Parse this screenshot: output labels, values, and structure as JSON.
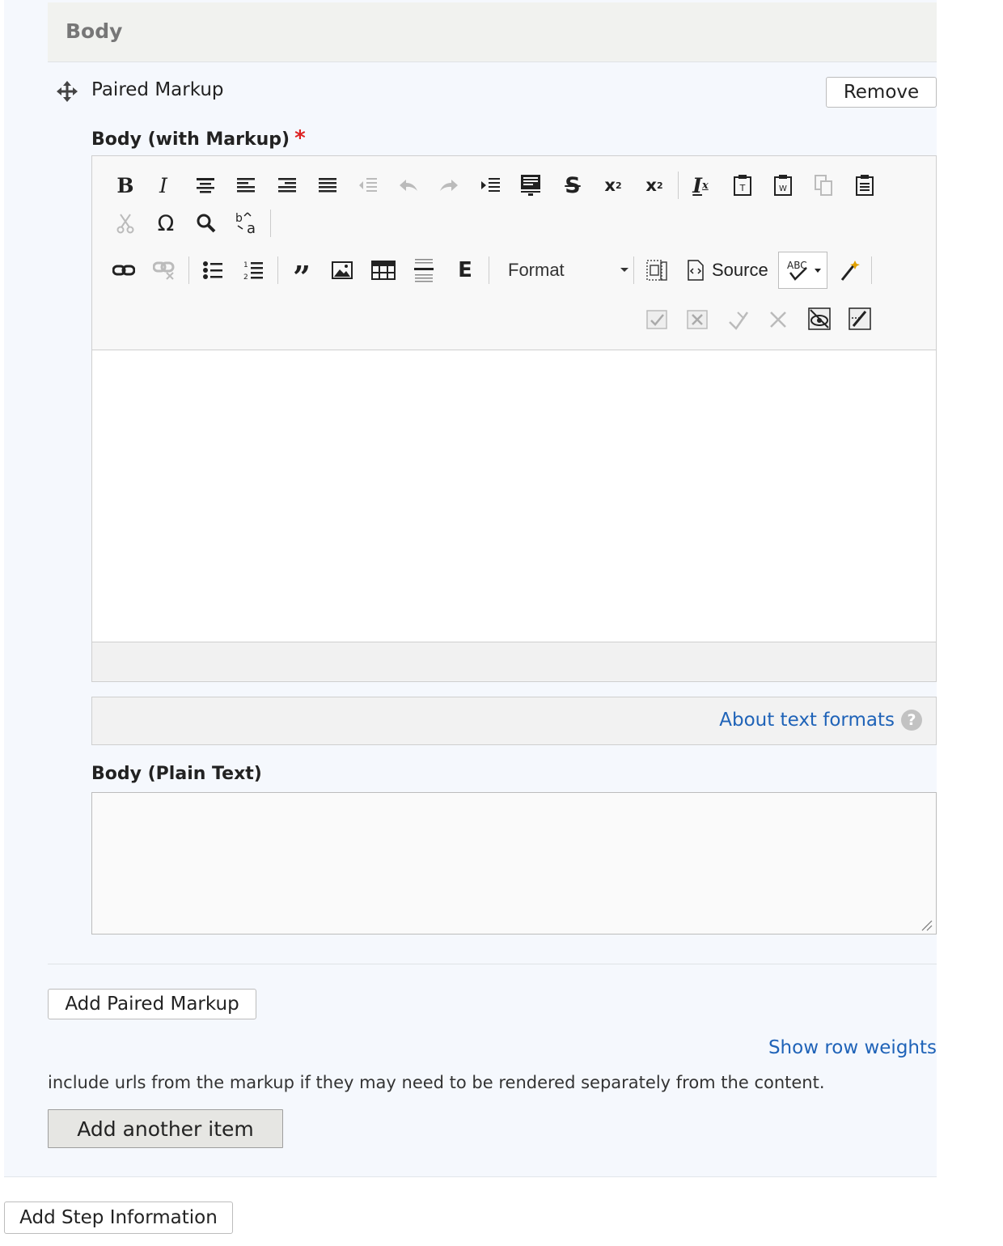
{
  "section": {
    "title": "Body"
  },
  "paragraph": {
    "title": "Paired Markup",
    "remove_label": "Remove",
    "icons": {
      "drag": "move-arrows-icon"
    }
  },
  "field_markup": {
    "label": "Body (with Markup)",
    "required_mark": "*",
    "toolbar": {
      "format_label": "Format",
      "source_label": "Source",
      "scayt_label": "ABC"
    },
    "content": ""
  },
  "text_formats": {
    "link": "About text formats",
    "help": "?"
  },
  "field_plain": {
    "label": "Body (Plain Text)",
    "value": ""
  },
  "actions": {
    "add_paired": "Add Paired Markup",
    "show_row_weights": "Show row weights",
    "description": "include urls from the markup if they may need to be rendered separately from the content.",
    "add_another": "Add another item",
    "add_step": "Add Step Information"
  },
  "colors": {
    "link": "#1f63b8",
    "required": "#dd2222",
    "panel": "#f5f8fd"
  }
}
